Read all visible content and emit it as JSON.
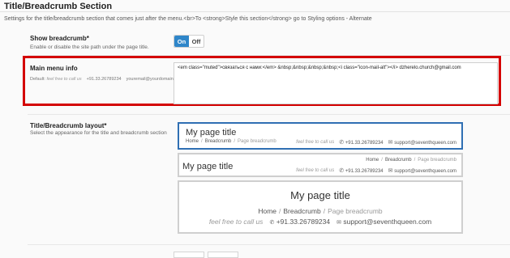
{
  "section": {
    "title": "Title/Breadcrumb Section",
    "description": "Settings for the title/breadcrumb section that comes just after the menu.<br>To <strong>Style this section</strong> go to Styling options - Alternate"
  },
  "show_breadcrumb": {
    "label": "Show breadcrumb*",
    "description": "Enable or disable the site path under the page title.",
    "on_label": "On",
    "off_label": "Off"
  },
  "main_menu_info": {
    "label": "Main menu info",
    "default_prefix": "Default:",
    "default_muted": "feel free to call us",
    "default_phone": "+91.33.26789234",
    "default_email": "youremail@yourdomain.com",
    "value": "<em class=\"muted\">связаться с нами:</em> &nbsp;&nbsp;&nbsp;&nbsp;<i class=\"icon-mail-alt\"></i> dzherelo.church@gmail.com"
  },
  "layout": {
    "label": "Title/Breadcrumb layout*",
    "description": "Select the appearance for the title and breadcrumb section",
    "page_title": "My page title",
    "bc_home": "Home",
    "bc_breadcrumb": "Breadcrumb",
    "bc_page": "Page breadcrumb",
    "bc_sep": "/",
    "call": "feel free to call us",
    "phone": "+91.33.26789234",
    "email": "support@seventhqueen.com"
  },
  "icons": {
    "phone": "phone-icon",
    "mail": "mail-icon"
  },
  "colors": {
    "accent": "#2f86c9",
    "highlight": "#d40000",
    "selected_border": "#2f6fb3"
  }
}
